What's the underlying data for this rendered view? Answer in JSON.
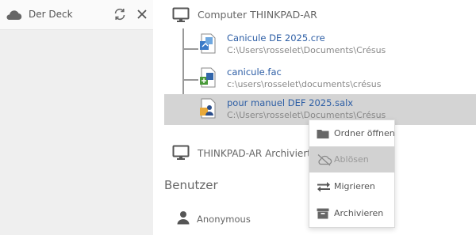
{
  "sidebar": {
    "title": "Der Deck",
    "icons": {
      "cloud": "cloud-icon",
      "sync": "sync-icon",
      "close": "close-icon"
    }
  },
  "computer": {
    "title": "Computer THINKPAD-AR",
    "icon": "monitor-icon"
  },
  "files": [
    {
      "name": "Canicule DE 2025.cre",
      "path": "C:\\Users\\rosselet\\Documents\\Crésus",
      "icon": "cresus-compta-icon",
      "selected": false
    },
    {
      "name": "canicule.fac",
      "path": "c:\\users\\rosselet\\documents\\crésus",
      "icon": "cresus-facturation-icon",
      "selected": false
    },
    {
      "name": "pour manuel DEF 2025.salx",
      "path": "C:\\Users\\rosselet\\Documents\\Crésus",
      "icon": "cresus-salaires-icon",
      "selected": true
    }
  ],
  "archive": {
    "title": "THINKPAD-AR Archiviert",
    "icon": "monitor-icon"
  },
  "users": {
    "title": "Benutzer",
    "items": [
      {
        "name": "Anonymous",
        "icon": "user-icon"
      }
    ]
  },
  "context_menu": {
    "items": [
      {
        "label": "Ordner öffnen",
        "icon": "folder-icon",
        "enabled": true
      },
      {
        "label": "Ablösen",
        "icon": "cloud-off-icon",
        "enabled": false
      },
      {
        "label": "Migrieren",
        "icon": "swap-arrows-icon",
        "enabled": true
      },
      {
        "label": "Archivieren",
        "icon": "archive-box-icon",
        "enabled": true
      }
    ]
  },
  "colors": {
    "sidebar_bg": "#efefef",
    "selected_row": "#d4d4d4",
    "link_blue": "#2d5ea5",
    "menu_highlight": "#d2d2d2"
  }
}
